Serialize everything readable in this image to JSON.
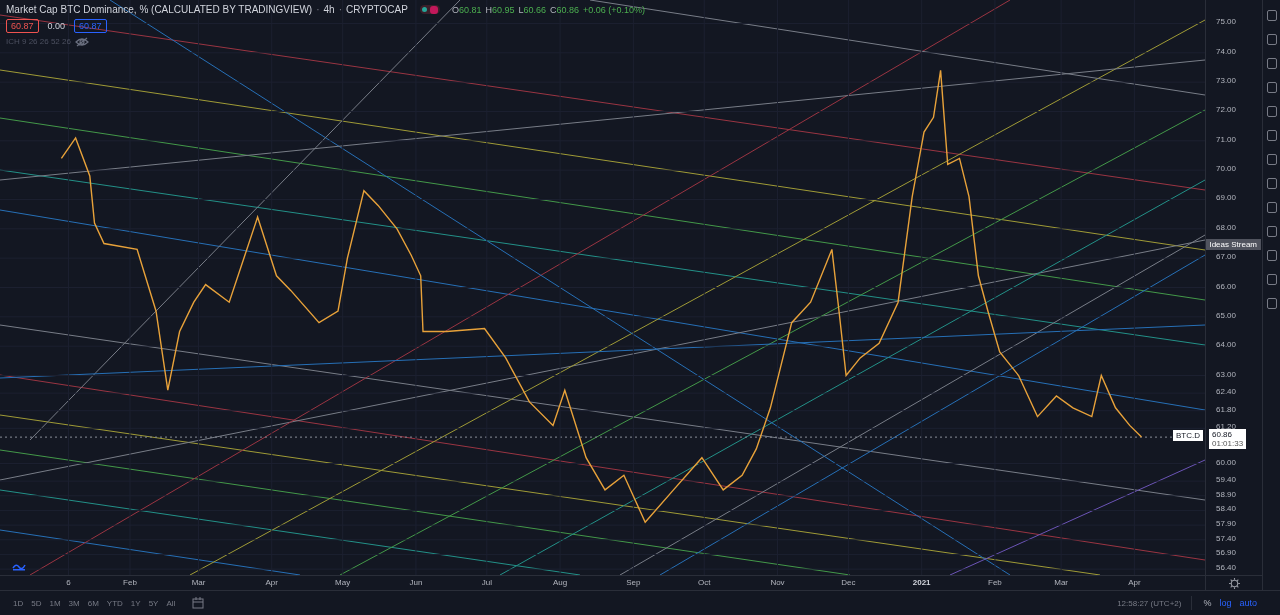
{
  "header": {
    "title": "Market Cap BTC Dominance, % (CALCULATED BY TRADINGVIEW)",
    "separator_1": "·",
    "interval": "4h",
    "separator_2": "·",
    "exchange": "CRYPTOCAP",
    "ohlc": [
      {
        "label": "O",
        "value": "60.81"
      },
      {
        "label": "H",
        "value": "60.95"
      },
      {
        "label": "L",
        "value": "60.66"
      },
      {
        "label": "C",
        "value": "60.86"
      }
    ],
    "change": "+0.06 (+0.10%)",
    "price_boxes": [
      {
        "value": "60.87",
        "kind": "sell"
      },
      {
        "value": "0.00",
        "kind": "spread"
      },
      {
        "value": "60.87",
        "kind": "buy"
      }
    ],
    "indicator": "ICH 9 26 26 52 26"
  },
  "chart": {
    "last_price": "60.86",
    "countdown": "01:01:33",
    "chart_data": {
      "type": "line",
      "xlim": [
        "2019-12-08",
        "2021-05-25"
      ],
      "grid": true,
      "ylim": [
        56.2,
        75.8
      ],
      "x": [
        "2020-01-03",
        "2020-01-09",
        "2020-01-15",
        "2020-01-17",
        "2020-01-21",
        "2020-02-04",
        "2020-02-12",
        "2020-02-17",
        "2020-02-22",
        "2020-02-28",
        "2020-03-04",
        "2020-03-14",
        "2020-03-26",
        "2020-04-03",
        "2020-04-09",
        "2020-04-21",
        "2020-04-29",
        "2020-05-03",
        "2020-05-10",
        "2020-05-16",
        "2020-05-24",
        "2020-05-30",
        "2020-06-03",
        "2020-06-04",
        "2020-06-14",
        "2020-06-30",
        "2020-07-09",
        "2020-07-19",
        "2020-07-29",
        "2020-08-03",
        "2020-08-12",
        "2020-08-20",
        "2020-08-28",
        "2020-09-06",
        "2020-09-18",
        "2020-09-30",
        "2020-10-09",
        "2020-10-17",
        "2020-10-23",
        "2020-10-29",
        "2020-11-07",
        "2020-11-15",
        "2020-11-24",
        "2020-11-27",
        "2020-11-30",
        "2020-12-06",
        "2020-12-14",
        "2020-12-22",
        "2020-12-28",
        "2021-01-02",
        "2021-01-06",
        "2021-01-09",
        "2021-01-12",
        "2021-01-17",
        "2021-01-21",
        "2021-01-25",
        "2021-01-29",
        "2021-02-03",
        "2021-02-11",
        "2021-02-19",
        "2021-02-27",
        "2021-03-06",
        "2021-03-14",
        "2021-03-18",
        "2021-03-24",
        "2021-03-30",
        "2021-04-04"
      ],
      "series": [
        {
          "name": "BTC.D",
          "color": "#e8a23a",
          "values": [
            70.4,
            71.1,
            69.8,
            68.2,
            67.5,
            67.3,
            65.2,
            62.5,
            64.5,
            65.5,
            66.1,
            65.5,
            68.4,
            66.4,
            65.9,
            64.8,
            65.2,
            67.0,
            69.3,
            68.8,
            68.0,
            67.1,
            66.4,
            64.5,
            64.5,
            64.6,
            63.6,
            62.1,
            61.3,
            62.5,
            60.2,
            59.1,
            59.6,
            58.0,
            59.1,
            60.2,
            59.1,
            59.6,
            60.5,
            61.9,
            64.8,
            65.5,
            67.3,
            65.2,
            63.0,
            63.6,
            64.1,
            65.5,
            69.1,
            71.3,
            71.8,
            73.4,
            70.2,
            70.4,
            69.1,
            66.4,
            65.2,
            63.8,
            63.0,
            61.6,
            62.3,
            61.9,
            61.6,
            63.0,
            61.9,
            61.3,
            60.9
          ]
        }
      ],
      "xticks": [
        {
          "value": "2020-01-06",
          "label": "6"
        },
        {
          "value": "2020-02-01",
          "label": "Feb"
        },
        {
          "value": "2020-03-01",
          "label": "Mar"
        },
        {
          "value": "2020-04-01",
          "label": "Apr"
        },
        {
          "value": "2020-05-01",
          "label": "May"
        },
        {
          "value": "2020-06-01",
          "label": "Jun"
        },
        {
          "value": "2020-07-01",
          "label": "Jul"
        },
        {
          "value": "2020-08-01",
          "label": "Aug"
        },
        {
          "value": "2020-09-01",
          "label": "Sep"
        },
        {
          "value": "2020-10-01",
          "label": "Oct"
        },
        {
          "value": "2020-11-01",
          "label": "Nov"
        },
        {
          "value": "2020-12-01",
          "label": "Dec"
        },
        {
          "value": "2021-01-01",
          "label": "2021"
        },
        {
          "value": "2021-02-01",
          "label": "Feb"
        },
        {
          "value": "2021-03-01",
          "label": "Mar"
        },
        {
          "value": "2021-04-01",
          "label": "Apr"
        }
      ],
      "yticks": [
        {
          "value": 75,
          "label": "75.00"
        },
        {
          "value": 74,
          "label": "74.00"
        },
        {
          "value": 73,
          "label": "73.00"
        },
        {
          "value": 72,
          "label": "72.00"
        },
        {
          "value": 71,
          "label": "71.00"
        },
        {
          "value": 70,
          "label": "70.00"
        },
        {
          "value": 69,
          "label": "69.00"
        },
        {
          "value": 68,
          "label": "68.00"
        },
        {
          "value": 67,
          "label": "67.00"
        },
        {
          "value": 66,
          "label": "66.00"
        },
        {
          "value": 65,
          "label": "65.00"
        },
        {
          "value": 64,
          "label": "64.00"
        },
        {
          "value": 63,
          "label": "63.00"
        },
        {
          "value": 62.4,
          "label": "62.40"
        },
        {
          "value": 61.8,
          "label": "61.80"
        },
        {
          "value": 61.2,
          "label": "61.20"
        },
        {
          "value": 60,
          "label": "60.00"
        },
        {
          "value": 59.4,
          "label": "59.40"
        },
        {
          "value": 58.9,
          "label": "58.90"
        },
        {
          "value": 58.4,
          "label": "58.40"
        },
        {
          "value": 57.9,
          "label": "57.90"
        },
        {
          "value": 57.4,
          "label": "57.40"
        },
        {
          "value": 56.9,
          "label": "56.90"
        },
        {
          "value": 56.4,
          "label": "56.40"
        }
      ]
    }
  },
  "sidebar": {
    "tooltip": "Ideas Stream"
  },
  "range_buttons": [
    "1D",
    "5D",
    "1M",
    "3M",
    "6M",
    "YTD",
    "1Y",
    "5Y",
    "All"
  ],
  "status_bar": {
    "time": "12:58:27 (UTC+2)",
    "percent": "%",
    "log": "log",
    "auto": "auto"
  }
}
